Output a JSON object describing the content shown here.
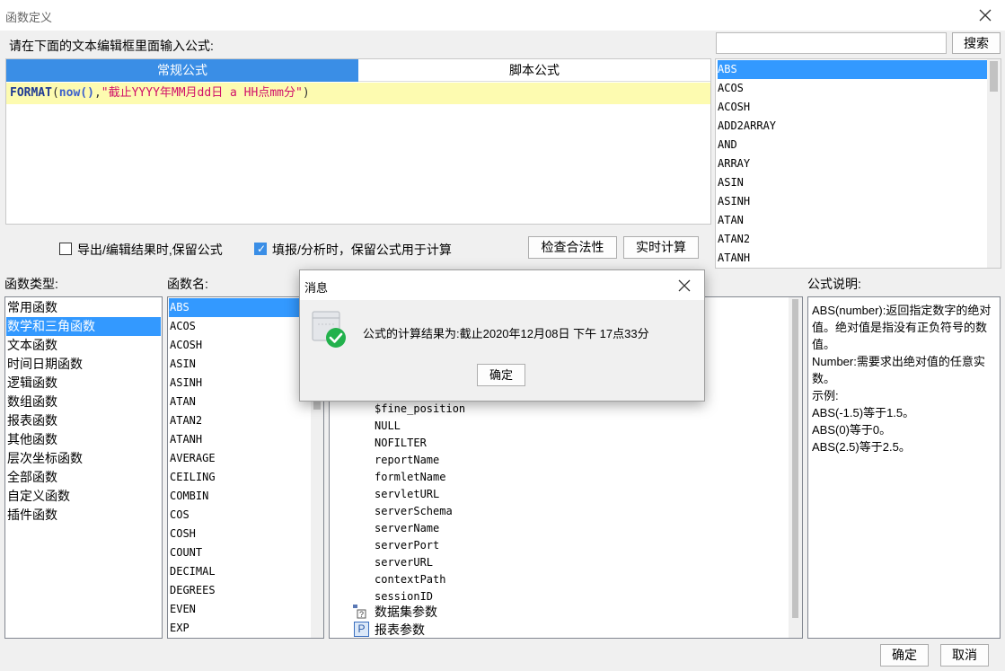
{
  "window": {
    "title": "函数定义"
  },
  "prompt": "请在下面的文本编辑框里面输入公式:",
  "editor": {
    "tabs": [
      "常规公式",
      "脚本公式"
    ],
    "formula": {
      "fn": "FORMAT",
      "open": "(",
      "now": "now()",
      "comma": ",",
      "str": "\"截止YYYY年MM月dd日 a HH点mm分\"",
      "close": ")"
    }
  },
  "search": {
    "value": "",
    "button": "搜索"
  },
  "top_function_list": [
    "ABS",
    "ACOS",
    "ACOSH",
    "ADD2ARRAY",
    "AND",
    "ARRAY",
    "ASIN",
    "ASINH",
    "ATAN",
    "ATAN2",
    "ATANH"
  ],
  "options": {
    "keep_on_export": "导出/编辑结果时,保留公式",
    "keep_on_fill": "填报/分析时，保留公式用于计算",
    "check_button": "检查合法性",
    "realtime_button": "实时计算"
  },
  "labels": {
    "function_type": "函数类型:",
    "function_name": "函数名:",
    "description": "公式说明:"
  },
  "function_types": [
    "常用函数",
    "数学和三角函数",
    "文本函数",
    "时间日期函数",
    "逻辑函数",
    "数组函数",
    "报表函数",
    "其他函数",
    "层次坐标函数",
    "全部函数",
    "自定义函数",
    "插件函数"
  ],
  "function_names": [
    "ABS",
    "ACOS",
    "ACOSH",
    "ASIN",
    "ASINH",
    "ATAN",
    "ATAN2",
    "ATANH",
    "AVERAGE",
    "CEILING",
    "COMBIN",
    "COS",
    "COSH",
    "COUNT",
    "DECIMAL",
    "DEGREES",
    "EVEN",
    "EXP"
  ],
  "params_tree": [
    "$fine_position",
    "NULL",
    "NOFILTER",
    "reportName",
    "formletName",
    "servletURL",
    "serverSchema",
    "serverName",
    "serverPort",
    "serverURL",
    "contextPath",
    "sessionID"
  ],
  "tree_groups": [
    {
      "icon": "dataset-params-icon",
      "label": "数据集参数"
    },
    {
      "icon": "report-params-icon",
      "label": "报表参数",
      "badge": "P"
    }
  ],
  "description": {
    "lines": [
      "ABS(number):返回指定数字的绝对值。绝对值是指没有正负符号的数值。",
      "Number:需要求出绝对值的任意实数。",
      "示例:",
      "ABS(-1.5)等于1.5。",
      "ABS(0)等于0。",
      "ABS(2.5)等于2.5。"
    ]
  },
  "footer": {
    "ok": "确定",
    "cancel": "取消"
  },
  "message_dialog": {
    "title": "消息",
    "text": "公式的计算结果为:截止2020年12月08日 下午 17点33分",
    "ok": "确定"
  },
  "colors": {
    "accent": "#3a8ee6",
    "selection": "#3399ff",
    "formula_bg": "#fdfbb0",
    "string": "#d0106a"
  }
}
